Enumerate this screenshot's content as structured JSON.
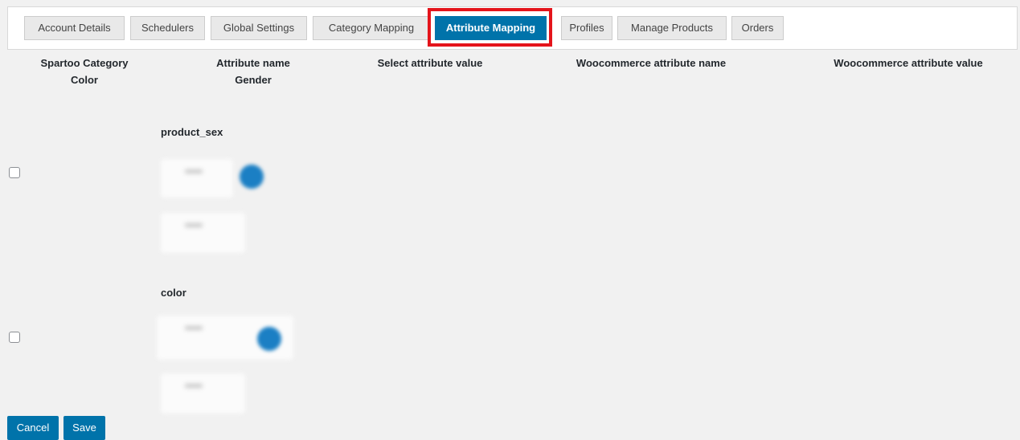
{
  "tabs": [
    {
      "label": "Account Details"
    },
    {
      "label": "Schedulers"
    },
    {
      "label": "Global Settings"
    },
    {
      "label": "Category Mapping"
    },
    {
      "label": "Attribute Mapping",
      "active": true
    },
    {
      "label": "Profiles"
    },
    {
      "label": "Manage Products"
    },
    {
      "label": "Orders"
    }
  ],
  "columns": {
    "category": {
      "title": "Spartoo Category",
      "value": "Color"
    },
    "attribute": {
      "title": "Attribute name",
      "value": "Gender"
    },
    "select_value": "Select attribute value",
    "woo_name": "Woocommerce attribute name",
    "woo_value": "Woocommerce attribute value"
  },
  "rows": [
    {
      "label": "product_sex"
    },
    {
      "label": "color"
    }
  ],
  "actions": {
    "cancel": "Cancel",
    "save": "Save"
  },
  "colors": {
    "accent": "#0073aa",
    "highlight": "#e4141b"
  }
}
